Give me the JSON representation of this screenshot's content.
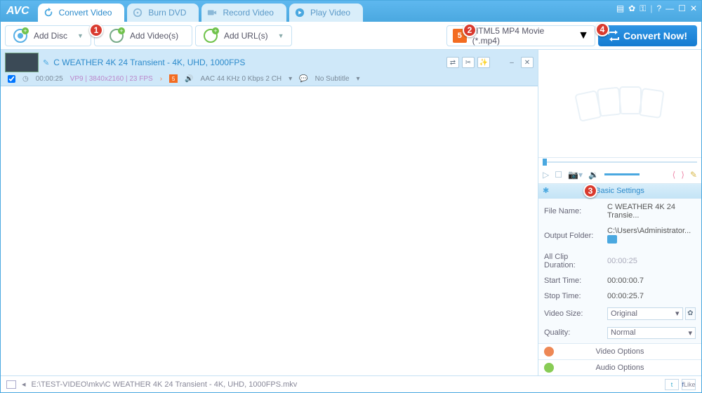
{
  "app": {
    "logo": "AVC"
  },
  "tabs": [
    {
      "label": "Convert Video"
    },
    {
      "label": "Burn DVD"
    },
    {
      "label": "Record Video"
    },
    {
      "label": "Play Video"
    }
  ],
  "toolbar": {
    "add_disc": "Add Disc",
    "add_videos": "Add Video(s)",
    "add_urls": "Add URL(s)",
    "output_format": "HTML5 MP4 Movie (*.mp4)",
    "convert": "Convert Now!"
  },
  "badges": {
    "b1": "1",
    "b2": "2",
    "b3": "3",
    "b4": "4"
  },
  "item": {
    "name": "C  WEATHER  4K 24  Transient - 4K, UHD, 1000FPS",
    "duration": "00:00:25",
    "res_fps": "VP9 | 3840x2160 | 23 FPS",
    "audio": "AAC 44 KHz 0 Kbps 2 CH",
    "subtitle": "No Subtitle"
  },
  "settings": {
    "header": "Basic Settings",
    "rows": {
      "file_name_lbl": "File Name:",
      "file_name_val": "C  WEATHER  4K 24  Transie...",
      "output_folder_lbl": "Output Folder:",
      "output_folder_val": "C:\\Users\\Administrator...",
      "clip_dur_lbl": "All Clip Duration:",
      "clip_dur_val": "00:00:25",
      "start_lbl": "Start Time:",
      "start_val": "00:00:00.7",
      "stop_lbl": "Stop Time:",
      "stop_val": "00:00:25.7",
      "vsize_lbl": "Video Size:",
      "vsize_val": "Original",
      "quality_lbl": "Quality:",
      "quality_val": "Normal"
    },
    "video_options": "Video Options",
    "audio_options": "Audio Options"
  },
  "statusbar": {
    "path": "E:\\TEST-VIDEO\\mkv\\C  WEATHER  4K 24  Transient - 4K, UHD, 1000FPS.mkv",
    "like": "Like"
  }
}
